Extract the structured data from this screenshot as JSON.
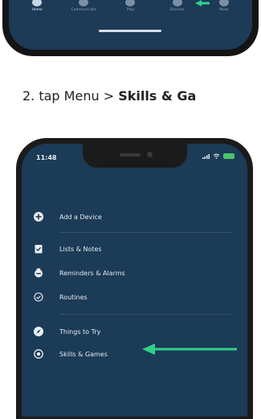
{
  "top_phone": {
    "tabs": [
      {
        "label": "Home",
        "active": true
      },
      {
        "label": "Communicate",
        "active": false
      },
      {
        "label": "Play",
        "active": false
      },
      {
        "label": "Devices",
        "active": false
      },
      {
        "label": "More",
        "active": false
      }
    ]
  },
  "instruction": {
    "prefix": "2.  tap Menu > ",
    "bold": "Skills & Ga"
  },
  "bottom_phone": {
    "time": "11:48",
    "menu_items": [
      {
        "label": "Add a Device",
        "icon": "plus-circle-icon"
      },
      {
        "label": "Lists & Notes",
        "icon": "checklist-icon"
      },
      {
        "label": "Reminders & Alarms",
        "icon": "alarm-icon"
      },
      {
        "label": "Routines",
        "icon": "routine-check-icon"
      },
      {
        "label": "Things to Try",
        "icon": "compass-icon"
      },
      {
        "label": "Skills & Games",
        "icon": "location-pin-icon"
      }
    ]
  },
  "colors": {
    "screen_bg": "#1c3b57",
    "arrow": "#2fd18a",
    "text": "#e3eaf1"
  }
}
